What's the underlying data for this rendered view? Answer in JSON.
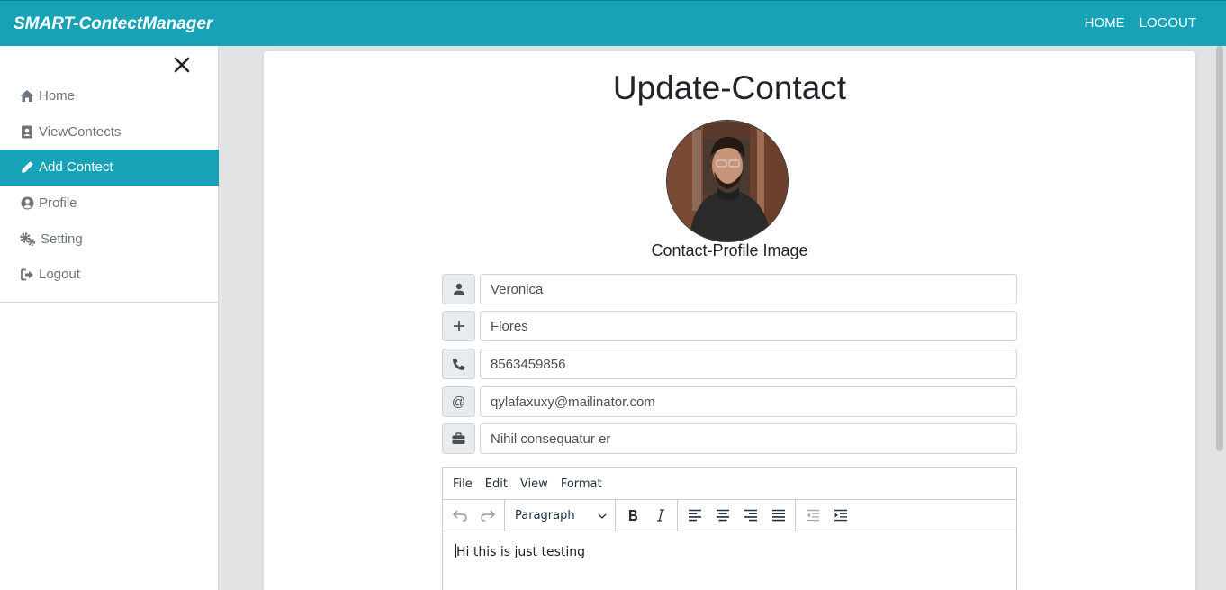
{
  "navbar": {
    "brand": "SMART-ContectManager",
    "links": [
      "HOME",
      "LOGOUT"
    ]
  },
  "sidebar": {
    "items": [
      {
        "label": "Home",
        "icon": "home-icon"
      },
      {
        "label": "ViewContects",
        "icon": "contact-book-icon"
      },
      {
        "label": "Add Contect",
        "icon": "pencil-icon",
        "active": true
      },
      {
        "label": "Profile",
        "icon": "user-circle-icon"
      },
      {
        "label": "Setting",
        "icon": "gears-icon"
      },
      {
        "label": "Logout",
        "icon": "sign-out-icon"
      }
    ]
  },
  "form": {
    "title": "Update-Contact",
    "image_caption": "Contact-Profile Image",
    "fields": [
      {
        "icon": "user-icon",
        "value": "Veronica"
      },
      {
        "icon": "plus-icon",
        "value": "Flores"
      },
      {
        "icon": "phone-icon",
        "value": "8563459856"
      },
      {
        "icon": "at-icon",
        "symbol": "@",
        "value": "qylafaxuxy@mailinator.com"
      },
      {
        "icon": "briefcase-icon",
        "value": "Nihil consequatur er"
      }
    ],
    "editor": {
      "menu": [
        "File",
        "Edit",
        "View",
        "Format"
      ],
      "block_format": "Paragraph",
      "content": "Hi this is just testing"
    }
  },
  "colors": {
    "primary": "#17a2b8",
    "background": "#e2e2e2"
  }
}
